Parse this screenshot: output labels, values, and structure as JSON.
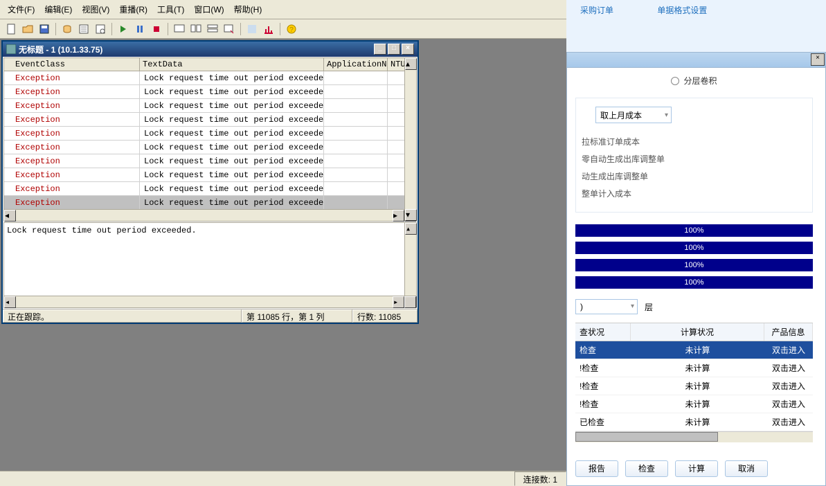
{
  "menubar": [
    "文件(F)",
    "编辑(E)",
    "视图(V)",
    "重播(R)",
    "工具(T)",
    "窗口(W)",
    "帮助(H)"
  ],
  "window": {
    "title": "无标题 - 1 (10.1.33.75)",
    "columns": {
      "event": "EventClass",
      "text": "TextData",
      "app": "ApplicationName",
      "nt": "NTUser"
    },
    "rows": [
      {
        "ev": "Exception",
        "td": "Lock request time out period exceeded."
      },
      {
        "ev": "Exception",
        "td": "Lock request time out period exceeded."
      },
      {
        "ev": "Exception",
        "td": "Lock request time out period exceeded."
      },
      {
        "ev": "Exception",
        "td": "Lock request time out period exceeded."
      },
      {
        "ev": "Exception",
        "td": "Lock request time out period exceeded."
      },
      {
        "ev": "Exception",
        "td": "Lock request time out period exceeded."
      },
      {
        "ev": "Exception",
        "td": "Lock request time out period exceeded."
      },
      {
        "ev": "Exception",
        "td": "Lock request time out period exceeded."
      },
      {
        "ev": "Exception",
        "td": "Lock request time out period exceeded."
      },
      {
        "ev": "Exception",
        "td": "Lock request time out period exceeded.",
        "selected": true
      }
    ],
    "detail": "Lock request time out period exceeded.",
    "status": {
      "tracing": "正在跟踪。",
      "pos": "第 11085 行，第 1 列",
      "rows": "行数: 11085"
    }
  },
  "bottom": {
    "conn": "连接数: 1"
  },
  "header_links": [
    "采购订单",
    "单据格式设置"
  ],
  "right": {
    "radio": "分层卷积",
    "combo": "取上月成本",
    "options": [
      "拉标准订单成本",
      "零自动生成出库调整单",
      "动生成出库调整单",
      "整单计入成本"
    ],
    "progress": [
      "100%",
      "100%",
      "100%",
      "100%"
    ],
    "level_value": ")",
    "level_label": "层",
    "thead": [
      "查状况",
      "计算状况",
      "产品信息"
    ],
    "rows": [
      {
        "c1": "检查",
        "c2": "未计算",
        "c3": "双击进入",
        "sel": true
      },
      {
        "c1": "!检查",
        "c2": "未计算",
        "c3": "双击进入"
      },
      {
        "c1": "!检查",
        "c2": "未计算",
        "c3": "双击进入"
      },
      {
        "c1": "!检查",
        "c2": "未计算",
        "c3": "双击进入"
      },
      {
        "c1": "已检查",
        "c2": "未计算",
        "c3": "双击进入"
      }
    ],
    "buttons": [
      "报告",
      "检查",
      "计算",
      "取消"
    ]
  }
}
